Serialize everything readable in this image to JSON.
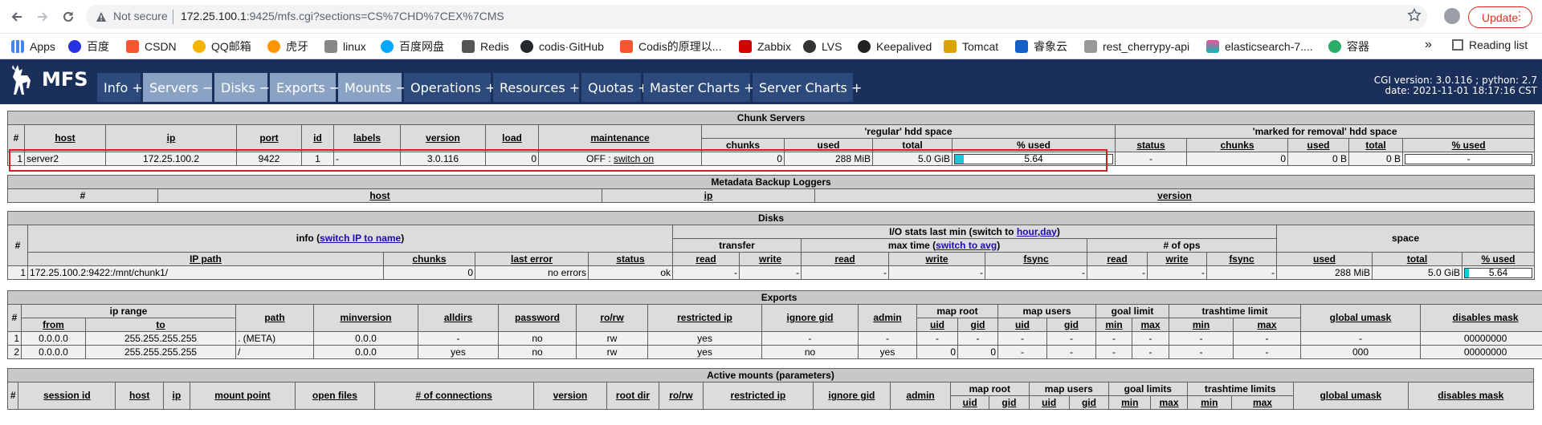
{
  "browser": {
    "not_secure": "Not secure",
    "url_host": "172.25.100.1",
    "url_rest": ":9425/mfs.cgi?sections=CS%7CHD%7CEX%7CMS",
    "update_label": "Update",
    "bookmarks": [
      "Apps",
      "百度",
      "CSDN",
      "QQ邮箱",
      "虎牙",
      "linux",
      "百度网盘",
      "Redis",
      "codis·GitHub",
      "Codis的原理以...",
      "Zabbix",
      "LVS",
      "Keepalived",
      "Tomcat",
      "睿象云",
      "rest_cherrypy-api",
      "elasticsearch-7....",
      "容器"
    ],
    "bookmarks_more": "»",
    "reading_list": "Reading list"
  },
  "header": {
    "logo": "MFS",
    "tabs": [
      "Info +",
      "Servers −",
      "Disks −",
      "Exports −",
      "Mounts −",
      "Operations +",
      "Resources +",
      "Quotas +",
      "Master Charts +",
      "Server Charts +"
    ],
    "cgi_version": "CGI version: 3.0.116 ; python: 2.7",
    "date": "date: 2021-11-01 18:17:16 CST"
  },
  "chunk_servers": {
    "title": "Chunk Servers",
    "regular_label": "'regular' hdd space",
    "marked_label": "'marked for removal' hdd space",
    "cols": {
      "num": "#",
      "host": "host",
      "ip": "ip",
      "port": "port",
      "id": "id",
      "labels": "labels",
      "version": "version",
      "load": "load",
      "maintenance": "maintenance",
      "chunks": "chunks",
      "used": "used",
      "total": "total",
      "pct": "% used",
      "status": "status"
    },
    "row": {
      "num": "1",
      "host": "server2",
      "ip": "172.25.100.2",
      "port": "9422",
      "id": "1",
      "labels": "-",
      "version": "3.0.116",
      "load": "0",
      "maint_state": "OFF : ",
      "maint_link": "switch on",
      "chunks": "0",
      "used": "288 MiB",
      "total": "5.0 GiB",
      "pct": "5.64",
      "pct_value": 5.64,
      "m_status": "-",
      "m_chunks": "0",
      "m_used": "0 B",
      "m_total": "0 B",
      "m_pct": "-"
    }
  },
  "metadata_loggers": {
    "title": "Metadata Backup Loggers",
    "cols": {
      "num": "#",
      "host": "host",
      "ip": "ip",
      "version": "version"
    }
  },
  "disks": {
    "title": "Disks",
    "info_pre": "info (",
    "info_link": "switch IP to name",
    "info_post": ")",
    "io_pre": "I/O stats last min (switch to ",
    "io_link1": "hour",
    "io_link2": "day",
    "io_post": ")",
    "transfer": "transfer",
    "maxtime_pre": "max time (",
    "maxtime_link": "switch to avg",
    "maxtime_post": ")",
    "ops": "# of ops",
    "space": "space",
    "cols": {
      "num": "#",
      "ip_path": "IP path",
      "chunks": "chunks",
      "last_error": "last error",
      "status": "status",
      "read": "read",
      "write": "write",
      "fsync": "fsync",
      "used": "used",
      "total": "total",
      "pct": "% used"
    },
    "row": {
      "num": "1",
      "ip_path": "172.25.100.2:9422:/mnt/chunk1/",
      "chunks": "0",
      "last_error": "no errors",
      "status": "ok",
      "t_read": "-",
      "t_write": "-",
      "m_read": "-",
      "m_write": "-",
      "m_fsync": "-",
      "o_read": "-",
      "o_write": "-",
      "o_fsync": "-",
      "used": "288 MiB",
      "total": "5.0 GiB",
      "pct": "5.64",
      "pct_value": 5.64
    }
  },
  "exports": {
    "title": "Exports",
    "ip_range": "ip range",
    "map_root": "map root",
    "map_users": "map users",
    "goal_limit": "goal limit",
    "trashtime_limit": "trashtime limit",
    "cols": {
      "num": "#",
      "from": "from",
      "to": "to",
      "path": "path",
      "minversion": "minversion",
      "alldirs": "alldirs",
      "password": "password",
      "rorw": "ro/rw",
      "restricted_ip": "restricted ip",
      "ignore_gid": "ignore gid",
      "admin": "admin",
      "uid": "uid",
      "gid": "gid",
      "min": "min",
      "max": "max",
      "global_umask": "global umask",
      "disables_mask": "disables mask"
    },
    "rows": [
      {
        "num": "1",
        "from": "0.0.0.0",
        "to": "255.255.255.255",
        "path": ". (META)",
        "minversion": "0.0.0",
        "alldirs": "-",
        "password": "no",
        "rorw": "rw",
        "restricted_ip": "yes",
        "ignore_gid": "-",
        "admin": "-",
        "mr_uid": "-",
        "mr_gid": "-",
        "mu_uid": "-",
        "mu_gid": "-",
        "g_min": "-",
        "g_max": "-",
        "t_min": "-",
        "t_max": "-",
        "umask": "-",
        "disables": "00000000"
      },
      {
        "num": "2",
        "from": "0.0.0.0",
        "to": "255.255.255.255",
        "path": "/",
        "minversion": "0.0.0",
        "alldirs": "yes",
        "password": "no",
        "rorw": "rw",
        "restricted_ip": "yes",
        "ignore_gid": "no",
        "admin": "yes",
        "mr_uid": "0",
        "mr_gid": "0",
        "mu_uid": "-",
        "mu_gid": "-",
        "g_min": "-",
        "g_max": "-",
        "t_min": "-",
        "t_max": "-",
        "umask": "000",
        "disables": "00000000"
      }
    ]
  },
  "mounts": {
    "title": "Active mounts (parameters)",
    "map_root": "map root",
    "map_users": "map users",
    "goal_limits": "goal limits",
    "trashtime_limits": "trashtime limits",
    "cols": {
      "num": "#",
      "session_id": "session id",
      "host": "host",
      "ip": "ip",
      "mount_point": "mount point",
      "open_files": "open files",
      "connections": "# of connections",
      "version": "version",
      "root_dir": "root dir",
      "rorw": "ro/rw",
      "restricted_ip": "restricted ip",
      "ignore_gid": "ignore gid",
      "admin": "admin",
      "uid": "uid",
      "gid": "gid",
      "min": "min",
      "max": "max",
      "global_umask": "global umask",
      "disables_mask": "disables mask"
    }
  }
}
